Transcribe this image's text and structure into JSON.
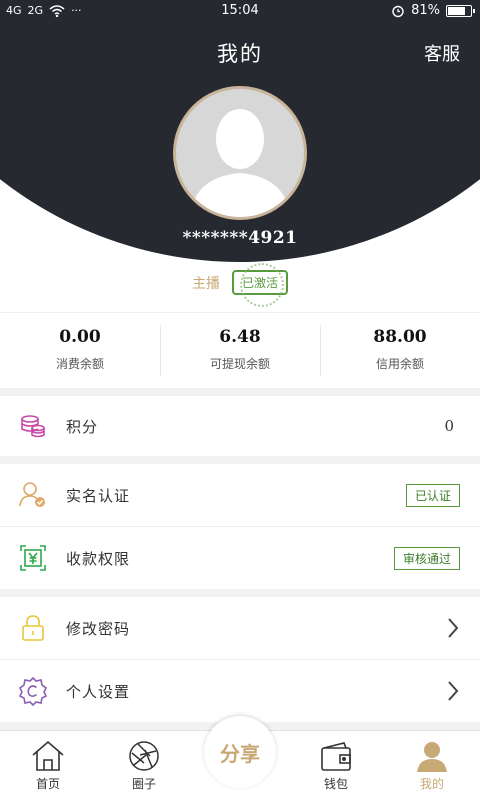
{
  "status_bar": {
    "signal_1": "4G",
    "signal_2": "2G",
    "dots": "···",
    "time": "15:04",
    "battery": "81%",
    "battery_level": 0.81
  },
  "header": {
    "title": "我的",
    "service": "客服"
  },
  "profile": {
    "account": "*******4921",
    "role": "主播",
    "status": "已激活"
  },
  "balances": [
    {
      "value": "0.00",
      "label": "消费余额"
    },
    {
      "value": "6.48",
      "label": "可提现余额"
    },
    {
      "value": "88.00",
      "label": "信用余额"
    }
  ],
  "menu": {
    "points": {
      "label": "积分",
      "value": "0"
    },
    "realname": {
      "label": "实名认证",
      "tag": "已认证"
    },
    "collect": {
      "label": "收款权限",
      "tag": "审核通过"
    },
    "password": {
      "label": "修改密码"
    },
    "settings": {
      "label": "个人设置"
    }
  },
  "tabs": {
    "home": "首页",
    "circle": "圈子",
    "share": "分享",
    "wallet": "钱包",
    "mine": "我的"
  },
  "colors": {
    "dark_bg": "#262a30",
    "accent_gold": "#c8a874",
    "green": "#5a9a3e"
  }
}
